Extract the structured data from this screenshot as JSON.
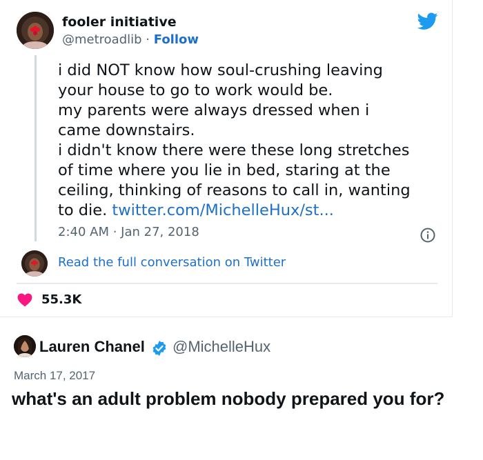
{
  "embed": {
    "author_name": "fooler initiative",
    "author_handle": "@metroadlib",
    "separator": " · ",
    "follow_label": "Follow",
    "text": "i did NOT know how soul-crushing leaving\nyour house to go to work would be.\nmy parents were always dressed when i\ncame downstairs.\ni didn't know there were these long stretches\nof time where you lie in bed, staring at the\nceiling, thinking of reasons to call in, wanting\nto die. ",
    "link_text": "twitter.com/MichelleHux/st...",
    "timestamp": "2:40 AM · Jan 27, 2018",
    "read_full_label": "Read the full conversation on Twitter",
    "like_count": "55.3K",
    "colors": {
      "link": "#1d6fc9",
      "twitter_blue": "#1d9bf0",
      "heart": "#f91880",
      "muted": "#536471"
    },
    "icons": [
      "twitter-bird-icon",
      "info-icon",
      "heart-icon"
    ]
  },
  "quoted": {
    "author_name": "Lauren Chanel",
    "author_handle": "@MichelleHux",
    "date": "March 17, 2017",
    "text": "what's an adult problem nobody prepared you for?",
    "icons": [
      "verified-badge-icon"
    ]
  }
}
